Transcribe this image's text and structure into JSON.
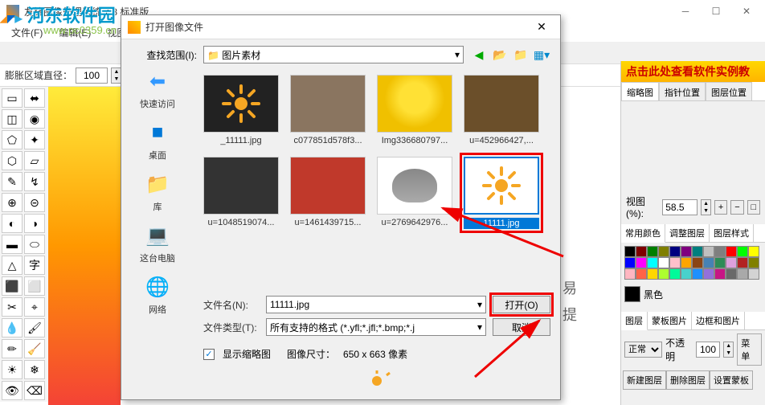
{
  "app": {
    "title": "友锋图像处理系统 7.8 标准版",
    "menus": [
      "文件(F)",
      "编辑(E)",
      "视图(V)",
      "..."
    ],
    "toolbar": {
      "label": "膨胀区域直径：",
      "value": "100"
    }
  },
  "watermark": {
    "brand": "河东软件园",
    "url": "www.pc0359.cn"
  },
  "right": {
    "banner": "点击此处查看软件实例教",
    "tabs": [
      "缩略图",
      "指针位置",
      "图层位置"
    ],
    "zoom_label": "视图(%):",
    "zoom_value": "58.5",
    "color_tabs": [
      "常用颜色",
      "调整图层",
      "图层样式"
    ],
    "current_color": "黑色",
    "layer_tabs": [
      "图层",
      "蒙板图片",
      "边框和图片"
    ],
    "blend": "正常",
    "opacity_label": "不透明",
    "opacity": "100",
    "menu_btn": "菜单",
    "layer_btns": [
      "新建图层",
      "删除图层",
      "设置蒙板"
    ]
  },
  "dialog": {
    "title": "打开图像文件",
    "lookup_label": "查找范围(I):",
    "folder": "图片素材",
    "sidebar": [
      {
        "icon": "⬅",
        "label": "快速访问",
        "color": "#3399ff"
      },
      {
        "icon": "■",
        "label": "桌面",
        "color": "#0078d7"
      },
      {
        "icon": "📁",
        "label": "库",
        "color": "#ffb400"
      },
      {
        "icon": "💻",
        "label": "这台电脑",
        "color": "#3399ff"
      },
      {
        "icon": "🌐",
        "label": "网络",
        "color": "#3399ff"
      }
    ],
    "files": [
      {
        "name": "_11111.jpg",
        "bg": "#222"
      },
      {
        "name": "c077851d578f3...",
        "bg": "#8a7560"
      },
      {
        "name": "Img336680797...",
        "bg": "#f2c94c"
      },
      {
        "name": "u=452966427,...",
        "bg": "#6b4f2a"
      },
      {
        "name": "u=1048519074...",
        "bg": "#333"
      },
      {
        "name": "u=1461439715...",
        "bg": "#c0392b"
      },
      {
        "name": "u=2769642976...",
        "bg": "#fff"
      },
      {
        "name": "11111.jpg",
        "bg": "#fff"
      }
    ],
    "filename_label": "文件名(N):",
    "filename_value": "11111.jpg",
    "filetype_label": "文件类型(T):",
    "filetype_value": "所有支持的格式 (*.yfl;*.jfl;*.bmp;*.j",
    "open_btn": "打开(O)",
    "cancel_btn": "取消",
    "preview_check": "显示缩略图",
    "preview_size_label": "图像尺寸：",
    "preview_size": "650 x 663 像素"
  },
  "side_chars": {
    "c1": "易",
    "c2": "提"
  },
  "tools": [
    "▭",
    "⬌",
    "◫",
    "◉",
    "⬠",
    "✦",
    "⬡",
    "▱",
    "✎",
    "↯",
    "⊕",
    "⊝",
    "◐",
    "◑",
    "▬",
    "⬭",
    "△",
    "字",
    "⬛",
    "⬜",
    "✂",
    "⌖",
    "💧",
    "🖌",
    "✏",
    "🧹",
    "☀",
    "❄",
    "👁",
    "⌫"
  ]
}
